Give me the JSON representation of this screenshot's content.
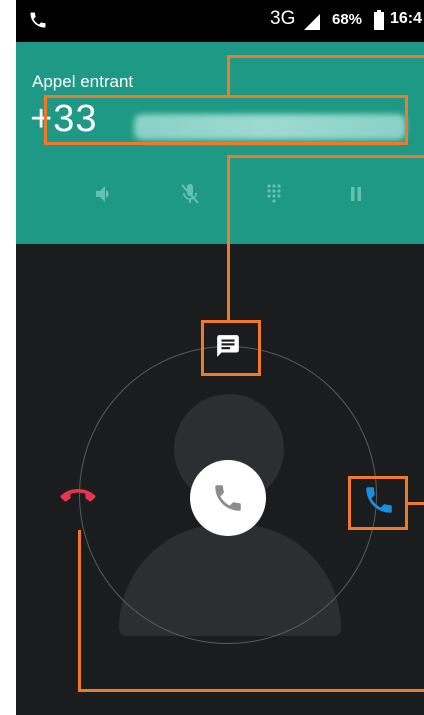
{
  "status_bar": {
    "network": "3G",
    "battery_percent": "68%",
    "time": "16:4"
  },
  "header": {
    "label": "Appel entrant",
    "number_prefix": "+33"
  },
  "controls": [
    {
      "name": "speaker-icon"
    },
    {
      "name": "mute-mic-icon"
    },
    {
      "name": "dialpad-icon"
    },
    {
      "name": "pause-icon"
    }
  ],
  "colors": {
    "header_bg": "#1e9985",
    "screen_bg": "#1b1c1e",
    "decline": "#e8344f",
    "answer": "#1a8fe0",
    "annotation": "#f07a2a"
  },
  "icons": {
    "status_call": "phone-icon",
    "message": "message-icon",
    "center": "phone-icon",
    "decline": "hang-up-icon",
    "answer": "answer-phone-icon"
  }
}
